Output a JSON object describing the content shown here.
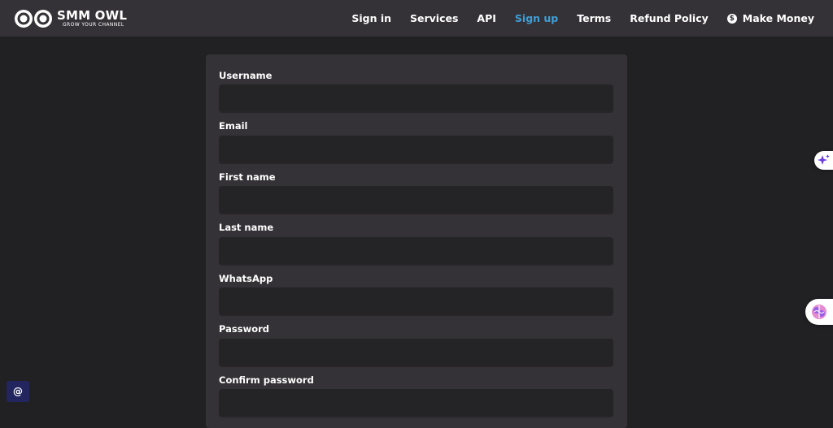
{
  "brand": {
    "name": "SMM OWL",
    "tagline": "GROW YOUR CHANNEL"
  },
  "nav": {
    "items": [
      {
        "label": "Sign in",
        "active": false
      },
      {
        "label": "Services",
        "active": false
      },
      {
        "label": "API",
        "active": false
      },
      {
        "label": "Sign up",
        "active": true
      },
      {
        "label": "Terms",
        "active": false
      },
      {
        "label": "Refund Policy",
        "active": false
      },
      {
        "label": "Make Money",
        "active": false,
        "icon": "dollar-icon"
      }
    ]
  },
  "form": {
    "fields": [
      {
        "label": "Username",
        "value": ""
      },
      {
        "label": "Email",
        "value": ""
      },
      {
        "label": "First name",
        "value": ""
      },
      {
        "label": "Last name",
        "value": ""
      },
      {
        "label": "WhatsApp",
        "value": ""
      },
      {
        "label": "Password",
        "value": ""
      },
      {
        "label": "Confirm password",
        "value": ""
      }
    ]
  },
  "widgets": {
    "email_symbol": "@",
    "dollar_symbol": "$"
  },
  "colors": {
    "background": "#212023",
    "navbar": "#343236",
    "card": "#343236",
    "input": "#242326",
    "accent": "#3f9fd8",
    "email_widget": "#23265e"
  }
}
